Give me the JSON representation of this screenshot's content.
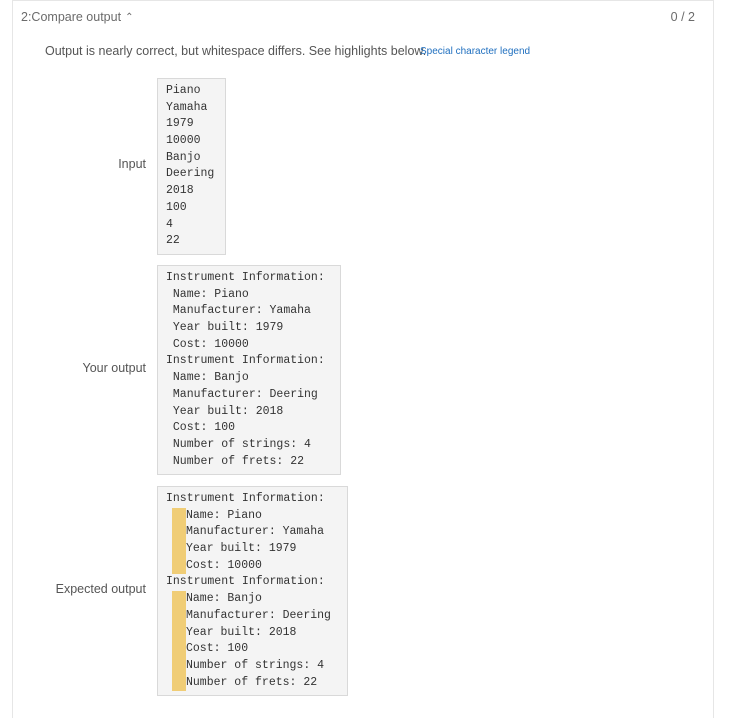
{
  "header": {
    "title": "2:Compare output",
    "score": "0 / 2"
  },
  "message": "Output is nearly correct, but whitespace differs. See highlights below.",
  "legend_link": "Special character legend",
  "input": {
    "label": "Input",
    "lines": [
      "Piano",
      "Yamaha",
      "1979",
      "10000",
      "Banjo",
      "Deering",
      "2018",
      "100",
      "4",
      "22"
    ]
  },
  "your_output": {
    "label": "Your output",
    "lines": [
      "Instrument Information:",
      " Name: Piano",
      " Manufacturer: Yamaha",
      " Year built: 1979",
      " Cost: 10000",
      "Instrument Information:",
      " Name: Banjo",
      " Manufacturer: Deering",
      " Year built: 2018",
      " Cost: 100",
      " Number of strings: 4",
      " Number of frets: 22"
    ]
  },
  "expected_output": {
    "label": "Expected output",
    "lines": [
      {
        "text": "Instrument Information:",
        "highlight": false
      },
      {
        "text": "Name: Piano",
        "highlight": true
      },
      {
        "text": "Manufacturer: Yamaha",
        "highlight": true
      },
      {
        "text": "Year built: 1979",
        "highlight": true
      },
      {
        "text": "Cost: 10000",
        "highlight": true
      },
      {
        "text": "Instrument Information:",
        "highlight": false
      },
      {
        "text": "Name: Banjo",
        "highlight": true
      },
      {
        "text": "Manufacturer: Deering",
        "highlight": true
      },
      {
        "text": "Year built: 2018",
        "highlight": true
      },
      {
        "text": "Cost: 100",
        "highlight": true
      },
      {
        "text": "Number of strings: 4",
        "highlight": true
      },
      {
        "text": "Number of frets: 22",
        "highlight": true
      }
    ]
  },
  "colors": {
    "highlight": "#f0cd76",
    "link": "#1f6fbf",
    "box_bg": "#f4f4f4"
  }
}
